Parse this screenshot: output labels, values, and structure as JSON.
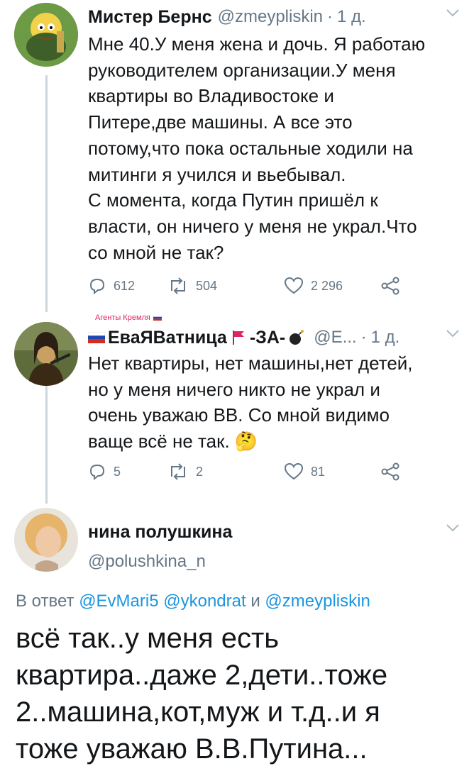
{
  "tweet1": {
    "name": "Мистер Бернс",
    "handle": "@zmeypliskin",
    "sep": "·",
    "time": "1 д.",
    "lines": [
      "Мне 40.У меня жена и дочь. Я работаю",
      "руководителем организации.У меня",
      "квартиры во Владивостоке и",
      "Питере,две машины. А все это",
      "потому,что пока остальные ходили на",
      "митинги я учился и вьебывал.",
      "С момента, когда Путин пришёл к",
      "власти, он ничего у меня не украл.Что",
      "со мной не так?"
    ],
    "replies": "612",
    "retweets": "504",
    "likes": "2 296"
  },
  "tweet2": {
    "badge": "Агенты Кремля",
    "name": "ЕваЯВатница",
    "name_tail": "-ЗА-",
    "handle": "@Е...",
    "sep": "·",
    "time": "1 д.",
    "lines": [
      "Нет квартиры, нет машины,нет детей,",
      "но у меня ничего никто не украл и",
      "очень уважаю ВВ. Со мной видимо",
      "ваще всё не так."
    ],
    "emoji": "🤔",
    "replies": "5",
    "retweets": "2",
    "likes": "81"
  },
  "tweet3": {
    "name": "нина полушкина",
    "handle": "@polushkina_n",
    "reply_prefix": "В ответ",
    "reply_to_1": "@EvMari5",
    "reply_to_2": "@ykondrat",
    "reply_joiner": "и",
    "reply_to_3": "@zmeypliskin",
    "lines": [
      "всё так..у меня есть",
      "квартира..даже 2,дети..тоже",
      "2..машина,кот,муж и т.д..и я",
      "тоже уважаю В.В.Путина..."
    ]
  },
  "colors": {
    "text": "#14171a",
    "muted": "#657786",
    "link": "#1b95e0",
    "thread": "#ccd6dd",
    "badge": "#e0245e"
  }
}
